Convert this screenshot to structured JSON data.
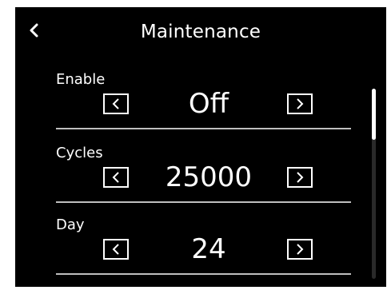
{
  "header": {
    "title": "Maintenance",
    "back_icon": "chevron-left-icon"
  },
  "settings": [
    {
      "label": "Enable",
      "value": "Off"
    },
    {
      "label": "Cycles",
      "value": "25000"
    },
    {
      "label": "Day",
      "value": "24"
    }
  ],
  "icons": {
    "decrement": "chevron-left-icon",
    "increment": "chevron-right-icon"
  },
  "scroll": {
    "position_fraction": 0.0,
    "visible_fraction": 0.27
  },
  "colors": {
    "background": "#000000",
    "foreground": "#ffffff",
    "divider": "#bfbfbf",
    "page": "#ffffff"
  }
}
